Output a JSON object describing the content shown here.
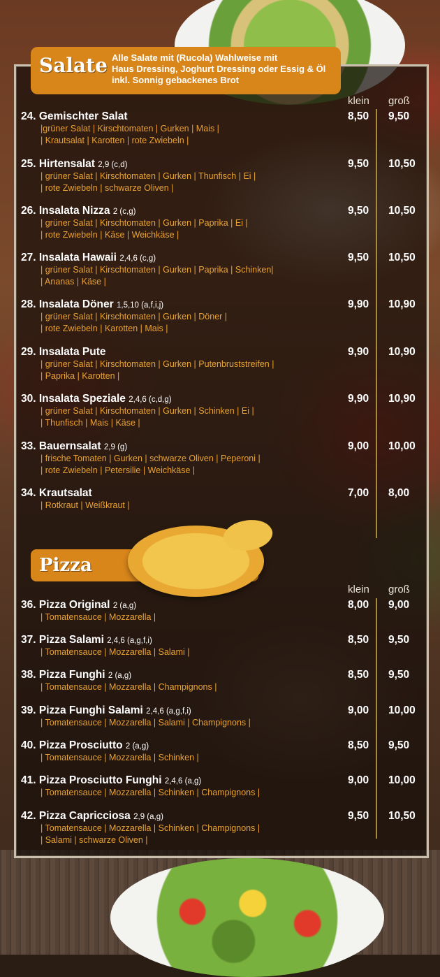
{
  "salate": {
    "title": "Salate",
    "note_line1": "Alle Salate mit (Rucola) Wahlweise mit",
    "note_line2": "Haus Dressing, Joghurt Dressing oder Essig & Öl",
    "note_line3": "inkl. Sonnig gebackenes Brot",
    "col_small": "klein",
    "col_large": "groß",
    "items": [
      {
        "name": "24. Gemischter Salat",
        "codes": "",
        "ing1": "|grüner Salat | Kirschtomaten | Gurken | Mais |",
        "ing2": "| Krautsalat | Karotten | rote Zwiebeln |",
        "small": "8,50",
        "large": "9,50"
      },
      {
        "name": "25. Hirtensalat",
        "codes": "2,9 (c,d)",
        "ing1": "| grüner Salat | Kirschtomaten | Gurken | Thunfisch | Ei |",
        "ing2": "| rote Zwiebeln | schwarze Oliven |",
        "small": "9,50",
        "large": "10,50"
      },
      {
        "name": "26. Insalata Nizza",
        "codes": "2 (c,g)",
        "ing1": "| grüner Salat | Kirschtomaten | Gurken | Paprika | Ei |",
        "ing2": "| rote Zwiebeln | Käse | Weichkäse |",
        "small": "9,50",
        "large": "10,50"
      },
      {
        "name": "27. Insalata Hawaii",
        "codes": "2,4,6 (c,g)",
        "ing1": "| grüner Salat | Kirschtomaten | Gurken | Paprika | Schinken|",
        "ing2": "| Ananas | Käse |",
        "small": "9,50",
        "large": "10,50"
      },
      {
        "name": "28. Insalata Döner",
        "codes": "1,5,10 (a,f,i,j)",
        "ing1": "| grüner Salat | Kirschtomaten | Gurken | Döner |",
        "ing2": "| rote Zwiebeln | Karotten | Mais |",
        "small": "9,90",
        "large": "10,90"
      },
      {
        "name": "29. Insalata Pute",
        "codes": "",
        "ing1": "| grüner Salat | Kirschtomaten | Gurken | Putenbruststreifen |",
        "ing2": "| Paprika | Karotten |",
        "small": "9,90",
        "large": "10,90"
      },
      {
        "name": "30. Insalata Speziale",
        "codes": "2,4,6 (c,d,g)",
        "ing1": "| grüner Salat | Kirschtomaten | Gurken | Schinken | Ei |",
        "ing2": "| Thunfisch | Mais | Käse |",
        "small": "9,90",
        "large": "10,90"
      },
      {
        "name": "33. Bauernsalat",
        "codes": "2,9 (g)",
        "ing1": "| frische Tomaten | Gurken | schwarze Oliven | Peperoni |",
        "ing2": "| rote Zwiebeln | Petersilie | Weichkäse |",
        "small": "9,00",
        "large": "10,00"
      },
      {
        "name": "34. Krautsalat",
        "codes": "",
        "ing1": "| Rotkraut | Weißkraut |",
        "ing2": "",
        "small": "7,00",
        "large": "8,00"
      }
    ]
  },
  "pizza": {
    "title": "Pizza",
    "col_small": "klein",
    "col_large": "groß",
    "items": [
      {
        "name": "36. Pizza Original",
        "codes": "2 (a,g)",
        "ing1": "| Tomatensauce | Mozzarella |",
        "ing2": "",
        "small": "8,00",
        "large": "9,00"
      },
      {
        "name": "37. Pizza Salami",
        "codes": "2,4,6 (a,g,f,i)",
        "ing1": "| Tomatensauce | Mozzarella | Salami |",
        "ing2": "",
        "small": "8,50",
        "large": "9,50"
      },
      {
        "name": "38. Pizza Funghi",
        "codes": "2 (a,g)",
        "ing1": "| Tomatensauce | Mozzarella | Champignons |",
        "ing2": "",
        "small": "8,50",
        "large": "9,50"
      },
      {
        "name": "39. Pizza Funghi Salami",
        "codes": "2,4,6 (a,g,f,i)",
        "ing1": "| Tomatensauce | Mozzarella | Salami | Champignons |",
        "ing2": "",
        "small": "9,00",
        "large": "10,00"
      },
      {
        "name": "40. Pizza Prosciutto",
        "codes": "2 (a,g)",
        "ing1": "| Tomatensauce | Mozzarella | Schinken |",
        "ing2": "",
        "small": "8,50",
        "large": "9,50"
      },
      {
        "name": "41. Pizza Prosciutto Funghi",
        "codes": "2,4,6 (a,g)",
        "ing1": "| Tomatensauce | Mozzarella | Schinken | Champignons |",
        "ing2": "",
        "small": "9,00",
        "large": "10,00"
      },
      {
        "name": "42. Pizza Capricciosa",
        "codes": "2,9 (a,g)",
        "ing1": "| Tomatensauce | Mozzarella | Schinken | Champignons |",
        "ing2": "| Salami | schwarze Oliven |",
        "small": "9,50",
        "large": "10,50"
      }
    ]
  },
  "colors": {
    "accent": "#d8861a",
    "ingredient": "#e9a233",
    "text": "#ffffff"
  }
}
